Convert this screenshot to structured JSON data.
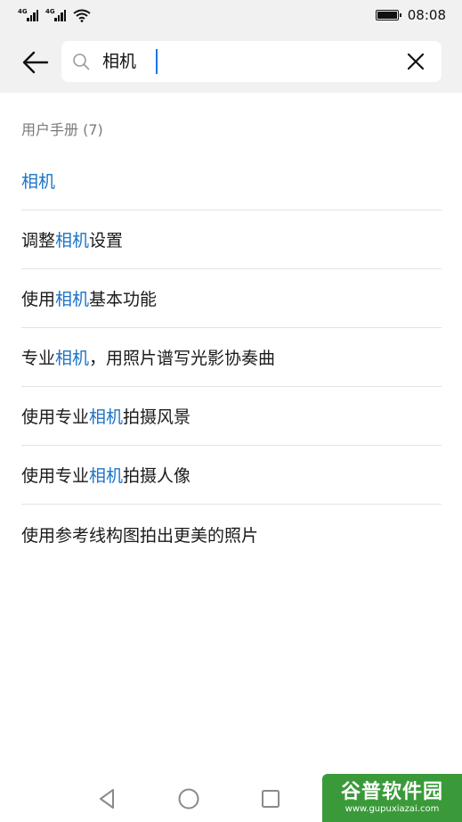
{
  "status_bar": {
    "net_1": "4G",
    "net_2": "4G",
    "time": "08:08",
    "battery_level": 1.0
  },
  "search": {
    "query": "相机",
    "icons": {
      "back": "arrow-left-icon",
      "search": "search-icon",
      "clear": "close-icon"
    },
    "accent_color": "#1a73e8"
  },
  "results_section": {
    "title": "用户手册 (7)",
    "highlight_color": "#1a73c8",
    "items": [
      {
        "before": "",
        "match": "相机",
        "after": ""
      },
      {
        "before": "调整",
        "match": "相机",
        "after": "设置"
      },
      {
        "before": "使用",
        "match": "相机",
        "after": "基本功能"
      },
      {
        "before": "专业",
        "match": "相机",
        "after": "，用照片谱写光影协奏曲"
      },
      {
        "before": "使用专业",
        "match": "相机",
        "after": "拍摄风景"
      },
      {
        "before": "使用专业",
        "match": "相机",
        "after": "拍摄人像"
      },
      {
        "before": "使用参考线构图拍出更美的照片",
        "match": "",
        "after": ""
      }
    ]
  },
  "nav_bar": {
    "icons": [
      "back-triangle-icon",
      "home-circle-icon",
      "recents-square-icon"
    ]
  },
  "watermark": {
    "main": "谷普软件园",
    "sub": "www.gupuxiazai.com"
  }
}
